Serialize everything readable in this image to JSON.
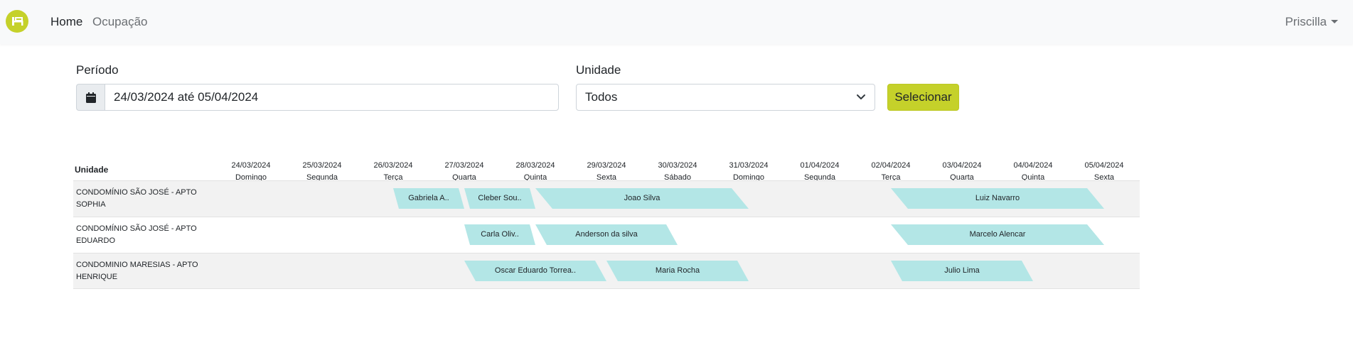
{
  "nav": {
    "home": "Home",
    "ocupacao": "Ocupação",
    "user": "Priscilla"
  },
  "form": {
    "periodo_label": "Período",
    "periodo_value": "24/03/2024 até 05/04/2024",
    "unidade_label": "Unidade",
    "unidade_value": "Todos",
    "button": "Selecionar"
  },
  "timeline": {
    "unit_header": "Unidade",
    "days": [
      {
        "date": "24/03/2024",
        "weekday": "Domingo"
      },
      {
        "date": "25/03/2024",
        "weekday": "Segunda"
      },
      {
        "date": "26/03/2024",
        "weekday": "Terça"
      },
      {
        "date": "27/03/2024",
        "weekday": "Quarta"
      },
      {
        "date": "28/03/2024",
        "weekday": "Quinta"
      },
      {
        "date": "29/03/2024",
        "weekday": "Sexta"
      },
      {
        "date": "30/03/2024",
        "weekday": "Sábado"
      },
      {
        "date": "31/03/2024",
        "weekday": "Domingo"
      },
      {
        "date": "01/04/2024",
        "weekday": "Segunda"
      },
      {
        "date": "02/04/2024",
        "weekday": "Terça"
      },
      {
        "date": "03/04/2024",
        "weekday": "Quarta"
      },
      {
        "date": "04/04/2024",
        "weekday": "Quinta"
      },
      {
        "date": "05/04/2024",
        "weekday": "Sexta"
      }
    ],
    "rows": [
      {
        "unit": "CONDOMÍNIO SÃO JOSÉ - APTO SOPHIA",
        "bookings": [
          {
            "guest": "Gabriela A..",
            "start": "26/03/2024",
            "end": "27/03/2024"
          },
          {
            "guest": "Cleber Sou..",
            "start": "27/03/2024",
            "end": "28/03/2024"
          },
          {
            "guest": "Joao Silva",
            "start": "28/03/2024",
            "end": "31/03/2024"
          },
          {
            "guest": "Luiz Navarro",
            "start": "02/04/2024",
            "end": "05/04/2024"
          }
        ]
      },
      {
        "unit": "CONDOMÍNIO SÃO JOSÉ - APTO EDUARDO",
        "bookings": [
          {
            "guest": "Carla Oliv..",
            "start": "27/03/2024",
            "end": "28/03/2024"
          },
          {
            "guest": "Anderson da silva",
            "start": "28/03/2024",
            "end": "30/03/2024"
          },
          {
            "guest": "Marcelo Alencar",
            "start": "02/04/2024",
            "end": "05/04/2024"
          }
        ]
      },
      {
        "unit": "CONDOMINIO MARESIAS - APTO HENRIQUE",
        "bookings": [
          {
            "guest": "Oscar Eduardo Torrea..",
            "start": "27/03/2024",
            "end": "29/03/2024"
          },
          {
            "guest": "Maria Rocha",
            "start": "29/03/2024",
            "end": "31/03/2024"
          },
          {
            "guest": "Julio Lima",
            "start": "02/04/2024",
            "end": "04/04/2024"
          }
        ]
      }
    ]
  },
  "colors": {
    "brand": "#c5d12a",
    "booking": "#b3e6e6"
  }
}
